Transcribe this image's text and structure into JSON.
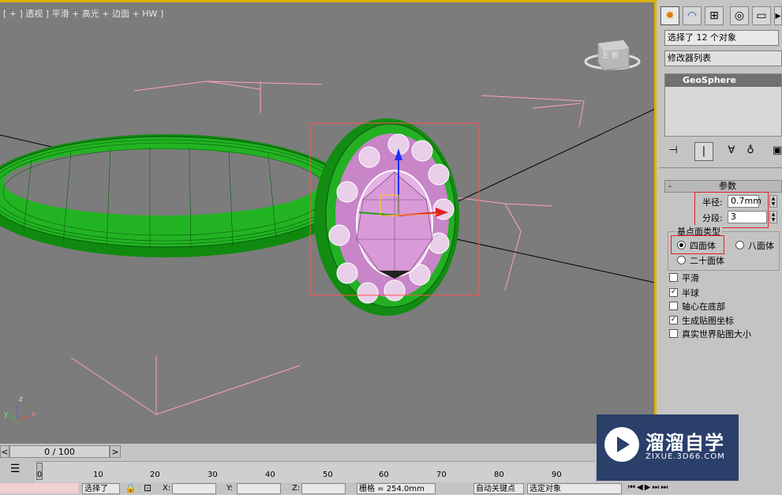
{
  "viewport": {
    "label": "[ + ] 透视 ] 平滑 + 高光 + 边面 + HW ]",
    "viewcube_text": "左  前",
    "axis_labels": {
      "z": "z",
      "x": "x",
      "y": "y"
    },
    "colors": {
      "background": "#7c7c7c",
      "ring": "#1fa51f",
      "gem": "#d9a6d9",
      "selection": "#ff5050",
      "highlight_border": "#e0b000"
    }
  },
  "command_panel": {
    "tabs": [
      {
        "icon": "create-icon",
        "glyph": "✸"
      },
      {
        "icon": "modify-icon",
        "glyph": "◠"
      },
      {
        "icon": "hierarchy-icon",
        "glyph": "⊞"
      },
      {
        "icon": "motion-icon",
        "glyph": "◎"
      },
      {
        "icon": "display-icon",
        "glyph": "▭"
      },
      {
        "icon": "utilities-icon",
        "glyph": "▸"
      }
    ],
    "selection_info": "选择了 12 个对象",
    "modifier_list": "修改器列表",
    "modifier_stack_item": "GeoSphere",
    "params_rollout": {
      "collapse": "-",
      "title": "参数",
      "radius_label": "半径:",
      "radius_value": "0.7mm",
      "segments_label": "分段:",
      "segments_value": "3",
      "base_type_group": "基点面类型",
      "base_types": [
        {
          "label": "四面体",
          "selected": true
        },
        {
          "label": "八面体",
          "selected": false
        },
        {
          "label": "二十面体",
          "selected": false
        }
      ],
      "checkboxes": [
        {
          "label": "平滑",
          "checked": false
        },
        {
          "label": "半球",
          "checked": true
        },
        {
          "label": "轴心在底部",
          "checked": false
        },
        {
          "label": "生成贴图坐标",
          "checked": true
        },
        {
          "label": "真实世界贴图大小",
          "checked": false
        }
      ]
    }
  },
  "timeline": {
    "frame_counter": "0 / 100",
    "prev": "<",
    "next": ">",
    "ticks": [
      "0",
      "10",
      "20",
      "30",
      "40",
      "50",
      "60",
      "70",
      "80",
      "90"
    ]
  },
  "status_bar": {
    "selection": "选择了",
    "x_label": "X:",
    "y_label": "Y:",
    "z_label": "Z:",
    "grid": "栅格 = 254.0mm",
    "auto_key": "自动关键点",
    "set_key_dropdown": "选定对象"
  },
  "watermark": {
    "title": "溜溜自学",
    "subtitle": "ZIXUE.3D66.COM"
  }
}
